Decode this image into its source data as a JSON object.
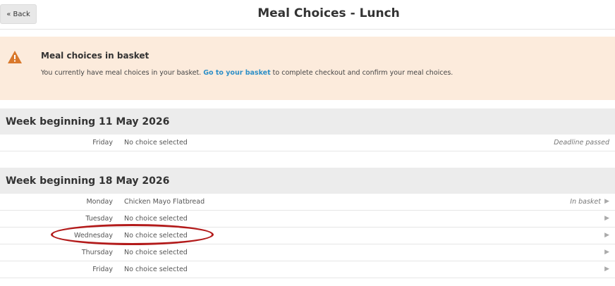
{
  "header": {
    "back_label": "« Back",
    "title": "Meal Choices - Lunch"
  },
  "alert": {
    "icon": "warning-icon",
    "title": "Meal choices in basket",
    "text_before": "You currently have meal choices in your basket.",
    "link_text": "Go to your basket",
    "text_after": "to complete checkout and confirm your meal choices."
  },
  "weeks": [
    {
      "heading": "Week beginning 11 May 2026",
      "days": [
        {
          "day": "Friday",
          "choice": "No choice selected",
          "status": "Deadline passed",
          "arrow": false
        }
      ]
    },
    {
      "heading": "Week beginning 18 May 2026",
      "days": [
        {
          "day": "Monday",
          "choice": "Chicken Mayo Flatbread",
          "status": "In basket",
          "arrow": true
        },
        {
          "day": "Tuesday",
          "choice": "No choice selected",
          "status": "",
          "arrow": true
        },
        {
          "day": "Wednesday",
          "choice": "No choice selected",
          "status": "",
          "arrow": true
        },
        {
          "day": "Thursday",
          "choice": "No choice selected",
          "status": "",
          "arrow": true
        },
        {
          "day": "Friday",
          "choice": "No choice selected",
          "status": "",
          "arrow": true
        }
      ]
    }
  ],
  "colors": {
    "alert_bg": "#fcebdc",
    "link": "#2d8fc7",
    "warning": "#d9782b",
    "highlight": "#b31b1b"
  }
}
